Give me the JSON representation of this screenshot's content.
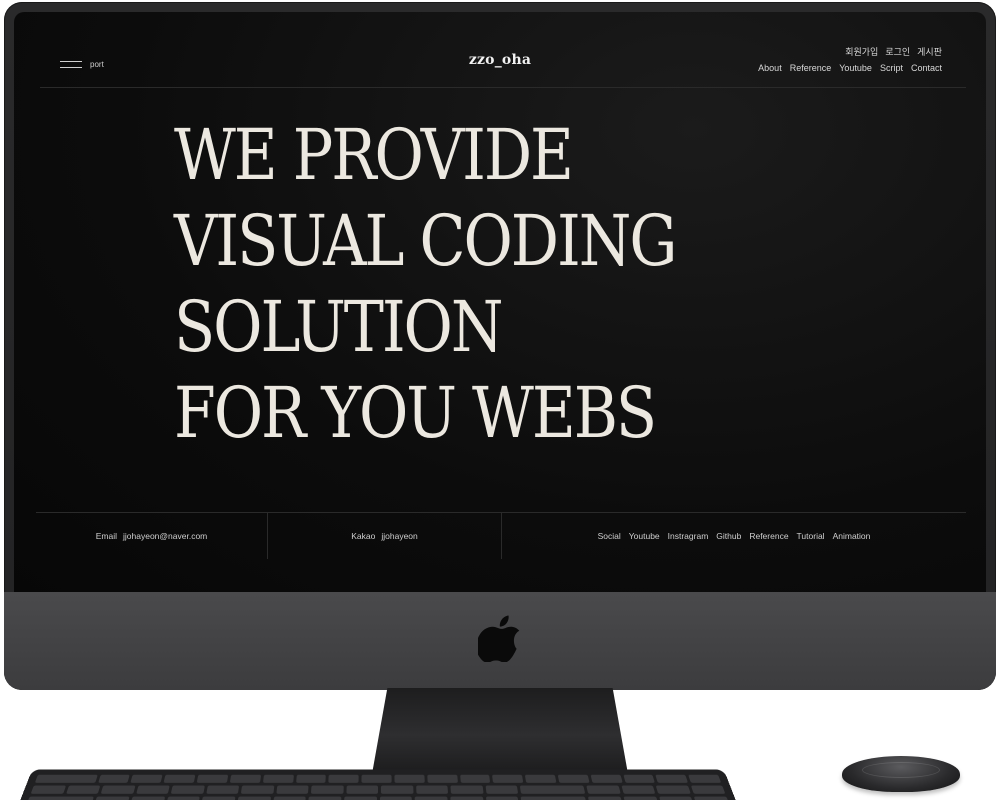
{
  "header": {
    "menu_label": "port",
    "logo": "zzo_oha",
    "util_nav": [
      "회원가입",
      "로그인",
      "게시판"
    ],
    "main_nav": [
      "About",
      "Reference",
      "Youtube",
      "Script",
      "Contact"
    ]
  },
  "hero": {
    "lines": [
      "WE PROVIDE",
      "VISUAL CODING",
      "SOLUTION",
      "FOR YOU WEBS"
    ]
  },
  "footer": {
    "email_label": "Email",
    "email_value": "jjohayeon@naver.com",
    "kakao_label": "Kakao",
    "kakao_value": "jjohayeon",
    "social_links": [
      "Social",
      "Youtube",
      "Instragram",
      "Github",
      "Reference",
      "Tutorial",
      "Animation"
    ]
  },
  "device": {
    "logo_icon": "apple-icon"
  },
  "colors": {
    "screen_bg": "#0b0b0b",
    "hero_text": "#ece8e0",
    "body_bezel": "#262627",
    "chin": "#424244"
  }
}
